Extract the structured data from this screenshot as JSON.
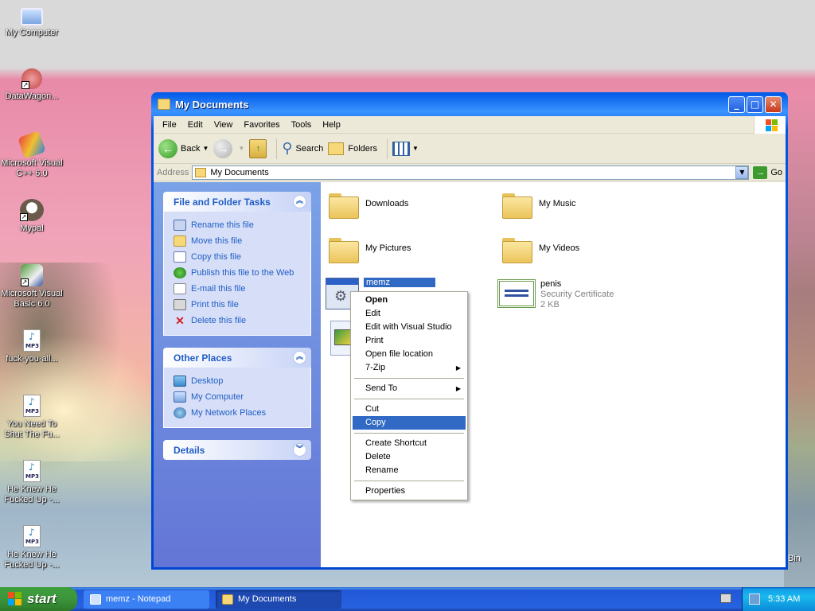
{
  "desktop": {
    "icons": [
      {
        "label": "My Computer",
        "icon": "computer-icon"
      },
      {
        "label": "DataWagon...",
        "icon": "datawagon-icon"
      },
      {
        "label": "Microsoft Visual C++ 6.0",
        "icon": "visual-cpp-icon"
      },
      {
        "label": "Mypal",
        "icon": "mypal-icon"
      },
      {
        "label": "Microsoft Visual Basic 6.0",
        "icon": "visual-basic-icon"
      },
      {
        "label": "fuck-you-all...",
        "icon": "mp3-file-icon"
      },
      {
        "label": "You Need To Shut The Fu...",
        "icon": "mp3-file-icon"
      },
      {
        "label": "He Knew He Fucked Up -...",
        "icon": "mp3-file-icon"
      },
      {
        "label": "He Knew He Fucked Up -...",
        "icon": "mp3-file-icon"
      }
    ],
    "partial_label": "Bin"
  },
  "window": {
    "title": "My Documents",
    "menu": [
      "File",
      "Edit",
      "View",
      "Favorites",
      "Tools",
      "Help"
    ],
    "toolbar": {
      "back": "Back",
      "search": "Search",
      "folders": "Folders"
    },
    "address": {
      "label": "Address",
      "value": "My Documents",
      "go": "Go"
    },
    "task_pane": {
      "file_tasks": {
        "title": "File and Folder Tasks",
        "items": [
          "Rename this file",
          "Move this file",
          "Copy this file",
          "Publish this file to the Web",
          "E-mail this file",
          "Print this file",
          "Delete this file"
        ]
      },
      "other_places": {
        "title": "Other Places",
        "items": [
          "Desktop",
          "My Computer",
          "My Network Places"
        ]
      },
      "details": {
        "title": "Details"
      }
    },
    "files": {
      "downloads": "Downloads",
      "my_music": "My Music",
      "my_pictures": "My Pictures",
      "my_videos": "My Videos",
      "memz": "memz",
      "penis_name": "penis",
      "penis_type": "Security Certificate",
      "penis_size": "2 KB"
    }
  },
  "context_menu": {
    "items": [
      {
        "label": "Open",
        "bold": true
      },
      {
        "label": "Edit"
      },
      {
        "label": "Edit with Visual Studio"
      },
      {
        "label": "Print"
      },
      {
        "label": "Open file location"
      },
      {
        "label": "7-Zip",
        "submenu": true
      },
      {
        "separator": true
      },
      {
        "label": "Send To",
        "submenu": true
      },
      {
        "separator": true
      },
      {
        "label": "Cut"
      },
      {
        "label": "Copy",
        "highlighted": true
      },
      {
        "separator": true
      },
      {
        "label": "Create Shortcut"
      },
      {
        "label": "Delete"
      },
      {
        "label": "Rename"
      },
      {
        "separator": true
      },
      {
        "label": "Properties"
      }
    ]
  },
  "taskbar": {
    "start": "start",
    "buttons": [
      {
        "label": "memz - Notepad",
        "active": false
      },
      {
        "label": "My Documents",
        "active": true
      }
    ],
    "clock": "5:33 AM"
  },
  "colors": {
    "selection": "#316ac5",
    "task_link": "#215dc6",
    "taskbar": "#2663e0",
    "start_green": "#3d953b"
  }
}
